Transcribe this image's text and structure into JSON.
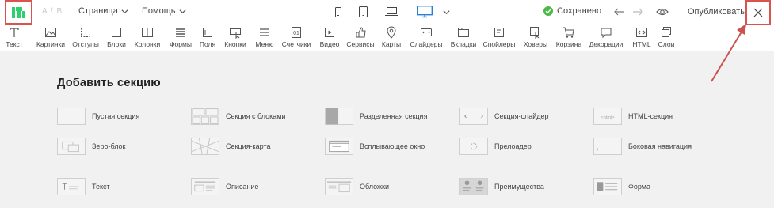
{
  "topbar": {
    "ab_label": "A / B",
    "menu_page": "Страница",
    "menu_help": "Помощь",
    "saved_label": "Сохранено",
    "publish_label": "Опубликовать"
  },
  "toolbar": {
    "items": [
      "Текст",
      "Картинки",
      "Отступы",
      "Блоки",
      "Колонки",
      "Формы",
      "Поля",
      "Кнопки",
      "Меню",
      "Счетчики",
      "Видео",
      "Сервисы",
      "Карты",
      "Слайдеры",
      "Вкладки",
      "Спойлеры",
      "Ховеры",
      "Корзина",
      "Декорации",
      "HTML",
      "Слои"
    ]
  },
  "main": {
    "heading": "Добавить секцию",
    "sections": [
      "Пустая секция",
      "Секция с блоками",
      "Разделенная секция",
      "Секция-слайдер",
      "HTML-секция",
      "Зеро-блок",
      "Секция-карта",
      "Всплывающее окно",
      "Прелоадер",
      "Боковая навигация",
      "Текст",
      "Описание",
      "Обложки",
      "Преимущества",
      "Форма"
    ],
    "html_thumb_text": "<html>"
  },
  "colors": {
    "brand_green": "#2ed06e",
    "saved_green": "#4cb848",
    "active_device_blue": "#2a7fd4",
    "annotation_red": "#c9534f"
  }
}
